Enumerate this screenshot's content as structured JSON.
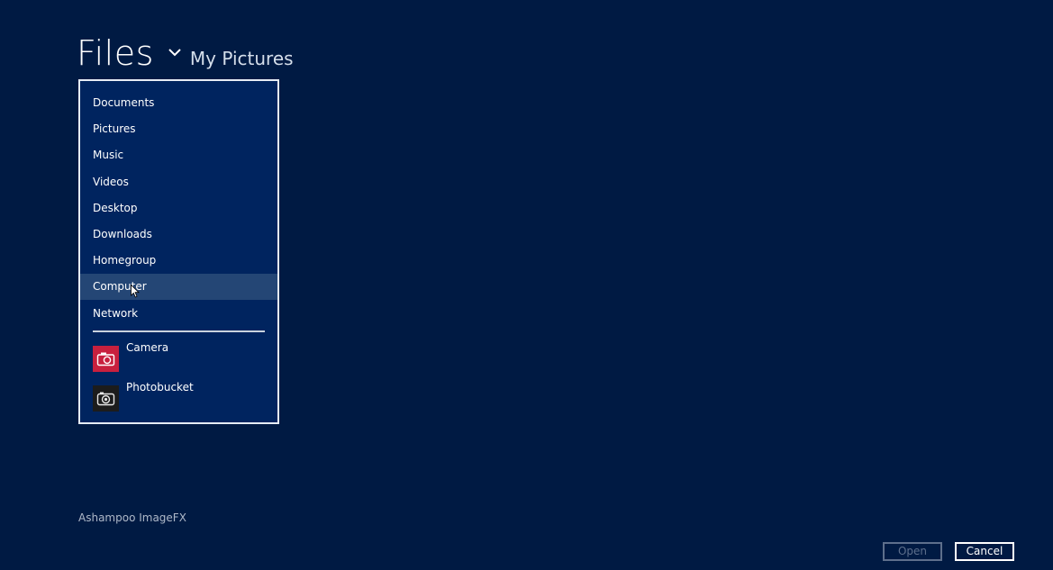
{
  "header": {
    "title": "Files",
    "location": "My Pictures"
  },
  "nav": {
    "items": [
      {
        "label": "Documents"
      },
      {
        "label": "Pictures"
      },
      {
        "label": "Music"
      },
      {
        "label": "Videos"
      },
      {
        "label": "Desktop"
      },
      {
        "label": "Downloads"
      },
      {
        "label": "Homegroup"
      },
      {
        "label": "Computer",
        "hovered": true
      },
      {
        "label": "Network"
      }
    ],
    "apps": [
      {
        "label": "Camera",
        "icon": "camera-icon",
        "icon_bg": "#c8203e"
      },
      {
        "label": "Photobucket",
        "icon": "photobucket-icon",
        "icon_bg": "#1c1c1c"
      }
    ]
  },
  "footer": {
    "app_name": "Ashampoo ImageFX",
    "open_label": "Open",
    "cancel_label": "Cancel"
  },
  "colors": {
    "background": "#001a43",
    "panel": "#00245f",
    "hover": "#244675",
    "border": "#e6ecf5"
  }
}
